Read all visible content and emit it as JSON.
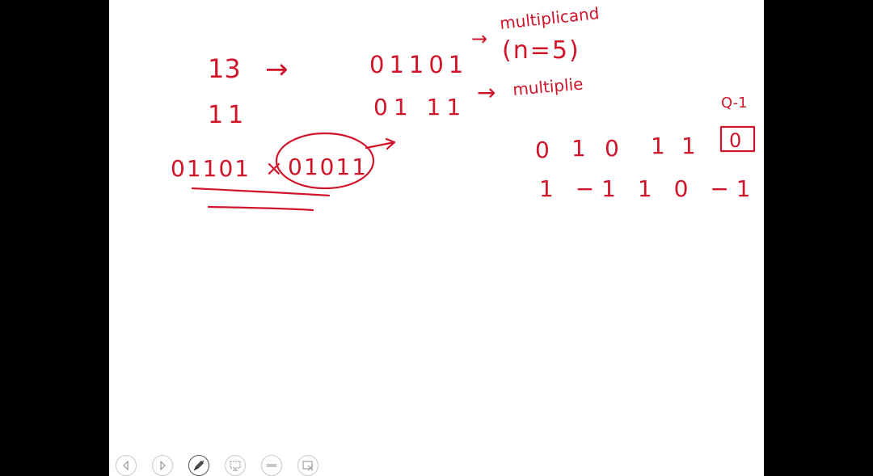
{
  "colors": {
    "ink": "#d0142a",
    "slide_bg": "#ffffff",
    "letterbox": "#000000",
    "toolbar_icon": "#a8a8a8"
  },
  "whiteboard": {
    "dec_13": "13",
    "arrow_13": "→",
    "bin_13": "01101",
    "arrow_multiplicand": "→",
    "label_multiplicand": "multiplicand",
    "label_n": "(n=5)",
    "dec_11": "11",
    "bin_11": "01 11",
    "arrow_multiplier": "→",
    "label_multiplier": "multiplie",
    "product_left": "01101",
    "product_times": "×",
    "product_right": "01011",
    "q_minus1": "Q-1",
    "booth_bits": [
      "0",
      "1",
      "0",
      "1",
      "1"
    ],
    "booth_q0": "0",
    "booth_recoded": "1 −1 1 0 −1"
  },
  "toolbar": {
    "icons": [
      "previous-icon",
      "next-icon",
      "pen-icon",
      "slide-view-icon",
      "more-options-icon",
      "exit-icon"
    ]
  }
}
